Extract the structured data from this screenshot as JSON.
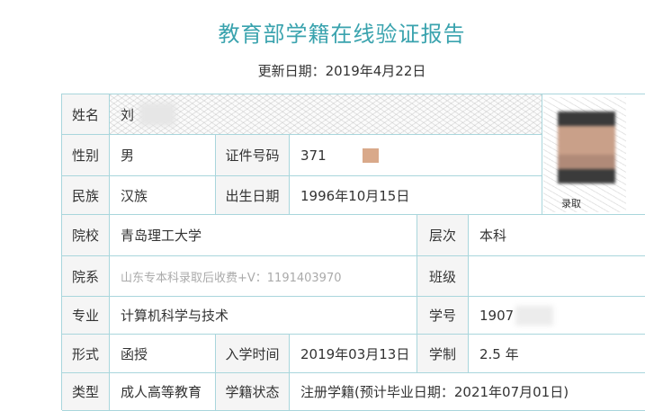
{
  "header": {
    "title": "教育部学籍在线验证报告",
    "update_date": "更新日期：2019年4月22日"
  },
  "labels": {
    "name": "姓名",
    "gender": "性别",
    "id_number": "证件号码",
    "ethnicity": "民族",
    "birth_date": "出生日期",
    "school": "院校",
    "level": "层次",
    "department": "院系",
    "class": "班级",
    "major": "专业",
    "student_id": "学号",
    "form": "形式",
    "enroll_date": "入学时间",
    "duration": "学制",
    "type": "类型",
    "status": "学籍状态"
  },
  "values": {
    "name": "刘",
    "gender": "男",
    "id_number": "371",
    "ethnicity": "汉族",
    "birth_date": "1996年10月15日",
    "school": "青岛理工大学",
    "level": "本科",
    "department": "山东专本科录取后收费+V：1191403970",
    "class": "",
    "major": "计算机科学与技术",
    "student_id": "1907",
    "form": "函授",
    "enroll_date": "2019年03月13日",
    "duration": "2.5 年",
    "type": "成人高等教育",
    "status": "注册学籍(预计毕业日期：2021年07月01日)"
  },
  "photo": {
    "caption": "录取"
  },
  "colors": {
    "accent": "#3aa3ae",
    "border": "#a9d6dc",
    "label_bg": "#f5f5f5"
  }
}
